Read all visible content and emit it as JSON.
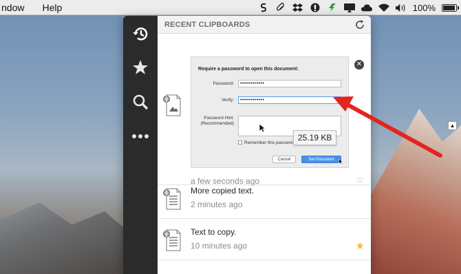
{
  "menubar": {
    "menus": [
      "ndow",
      "Help"
    ],
    "battery_percent": "100%",
    "battery_level": 1.0
  },
  "sidebar": {
    "items": [
      {
        "name": "history",
        "icon": "history-icon"
      },
      {
        "name": "favorites",
        "icon": "star-icon"
      },
      {
        "name": "search",
        "icon": "search-icon"
      },
      {
        "name": "more",
        "icon": "more-icon"
      }
    ]
  },
  "header": {
    "title": "RECENT CLIPBOARDS",
    "refresh_icon": "refresh-icon"
  },
  "clips": [
    {
      "type": "image",
      "time": "a few seconds ago",
      "starred": false,
      "thumbnail": {
        "heading": "Require a password to open this document:",
        "password_label": "Password:",
        "password_value": "••••••••••••",
        "verify_label": "Verify:",
        "verify_value": "••••••••••••",
        "hint_label": "Password Hint:",
        "hint_label_2": "(Recommended)",
        "remember_label": "Remember this password in my keychain",
        "cancel_label": "Cancel",
        "set_label": "Set Password",
        "tooltip": "25.19 KB"
      }
    },
    {
      "type": "text",
      "title": "More copied text.",
      "time": "2 minutes ago",
      "starred": false
    },
    {
      "type": "text",
      "title": "Text to copy.",
      "time": "10 minutes ago",
      "starred": true
    }
  ],
  "colors": {
    "sidebar": "#2b2b2b",
    "star_active": "#f5b82e",
    "star_inactive": "#c8c8c8",
    "arrow": "#e3251f"
  }
}
